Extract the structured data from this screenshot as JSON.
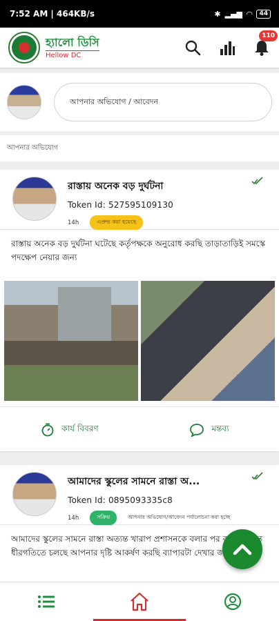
{
  "status_bar": {
    "time_speed": "7:52 AM | 464KB/s",
    "battery": "44"
  },
  "app": {
    "name_bn": "হ্যালো ডিসি",
    "name_en": "Hellow DC",
    "notification_count": "110",
    "brand_colors": {
      "green": "#1e8e3e",
      "red": "#d32f2f"
    }
  },
  "composer": {
    "placeholder": "আপনার অভিযোগ / আবেদন"
  },
  "section": {
    "label": "আপনার অভিযোগ"
  },
  "posts": [
    {
      "title": "রাস্তায় অনেক বড় দুর্ঘটনা",
      "token": "Token Id: 527595109130",
      "time": "14h",
      "status": "এপ্রুভ করা হয়েছে",
      "body": "রাস্তায় অনেক বড় দুর্ঘটনা ঘটেছে কর্তৃপক্ষকে অনুরোধ করছি তাড়াতাড়িই সমস্কে পদক্ষেপ নেয়ার জন্য",
      "action_progress": "কার্য বিবরণ",
      "action_comment": "মন্তব্য"
    },
    {
      "title": "আমাদের স্কুলের সামনে রাস্তা অ...",
      "token": "Token Id: 0895093335c8",
      "time": "14h",
      "status": "সক্রিয়",
      "note": "আপনার অভিযোগ/আবেদন পর্যালোচনা করা হচ্ছে",
      "body": "আমাদের স্কুলের সামনে রাস্তা অত্যন্ত খারাপ প্রশাসনকে বলার পর কাজ অত্যন্ত ধীরগতিতে চলছে আপনার দৃষ্টি আকর্ষণ করছি ব্যাপারটা দেখার জন্য"
    }
  ],
  "icons": {
    "search": "search-icon",
    "stats": "bar-chart-icon",
    "bell": "bell-icon",
    "check": "check-icon",
    "fab": "chevron-up-icon",
    "nav": [
      "list-icon",
      "home-icon",
      "user-icon"
    ]
  }
}
